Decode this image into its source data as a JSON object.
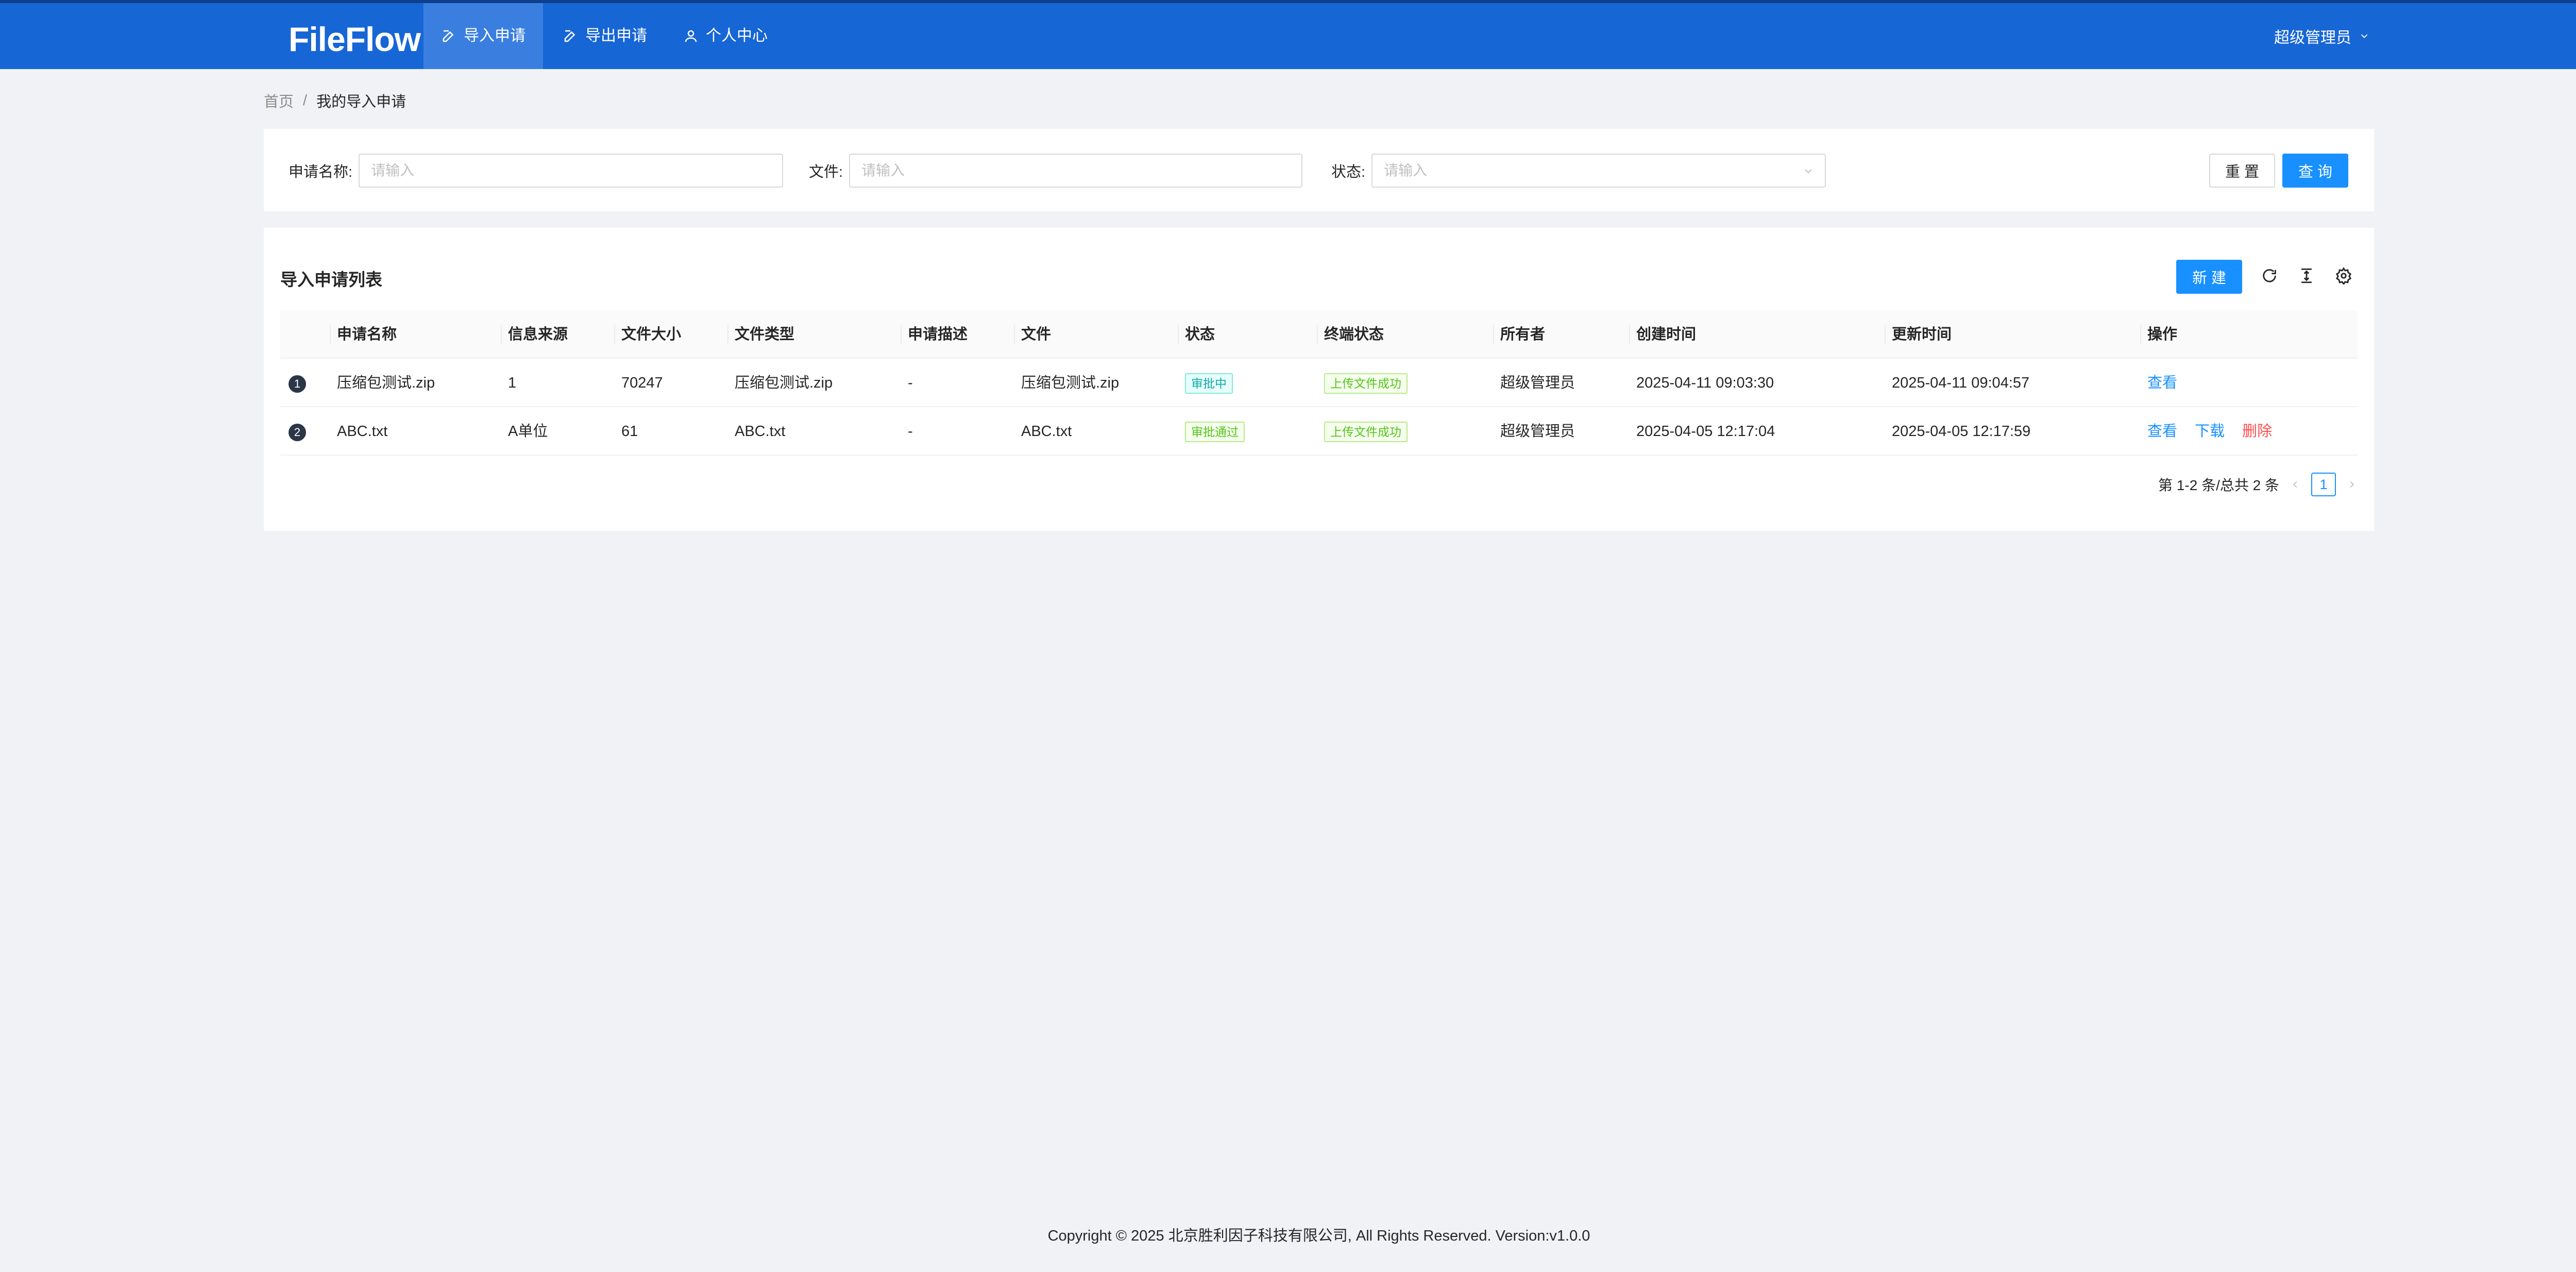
{
  "header": {
    "logo": "FileFlow",
    "nav": [
      {
        "label": "导入申请",
        "icon": "edit-icon",
        "active": true
      },
      {
        "label": "导出申请",
        "icon": "edit-icon",
        "active": false
      },
      {
        "label": "个人中心",
        "icon": "user-icon",
        "active": false
      }
    ],
    "user": "超级管理员"
  },
  "breadcrumb": {
    "home": "首页",
    "separator": "/",
    "current": "我的导入申请"
  },
  "search": {
    "name_label": "申请名称:",
    "name_placeholder": "请输入",
    "file_label": "文件:",
    "file_placeholder": "请输入",
    "status_label": "状态:",
    "status_placeholder": "请输入",
    "reset_label": "重 置",
    "query_label": "查 询"
  },
  "table": {
    "title": "导入申请列表",
    "new_label": "新 建",
    "columns": [
      "申请名称",
      "信息来源",
      "文件大小",
      "文件类型",
      "申请描述",
      "文件",
      "状态",
      "终端状态",
      "所有者",
      "创建时间",
      "更新时间",
      "操作"
    ],
    "rows": [
      {
        "index": "1",
        "name": "压缩包测试.zip",
        "source": "1",
        "size": "70247",
        "type": "压缩包测试.zip",
        "desc": "-",
        "file": "压缩包测试.zip",
        "status": "审批中",
        "status_color": "#13a8a8",
        "terminal_status": "上传文件成功",
        "owner": "超级管理员",
        "created": "2025-04-11 09:03:30",
        "updated": "2025-04-11 09:04:57",
        "actions": {
          "view": "查看"
        }
      },
      {
        "index": "2",
        "name": "ABC.txt",
        "source": "A单位",
        "size": "61",
        "type": "ABC.txt",
        "desc": "-",
        "file": "ABC.txt",
        "status": "审批通过",
        "status_color": "#52c41a",
        "terminal_status": "上传文件成功",
        "owner": "超级管理员",
        "created": "2025-04-05 12:17:04",
        "updated": "2025-04-05 12:17:59",
        "actions": {
          "view": "查看",
          "download": "下载",
          "delete": "删除"
        }
      }
    ],
    "pagination": {
      "summary": "第 1-2 条/总共 2 条",
      "current": "1"
    }
  },
  "footer": {
    "copyright": "Copyright © 2025 北京胜利因子科技有限公司, All Rights Reserved. Version:v1.0.0"
  },
  "colors": {
    "header_bg": "#1766d6",
    "primary": "#1890ff",
    "danger": "#ff4d4f",
    "page_bg": "#f0f2f5"
  }
}
